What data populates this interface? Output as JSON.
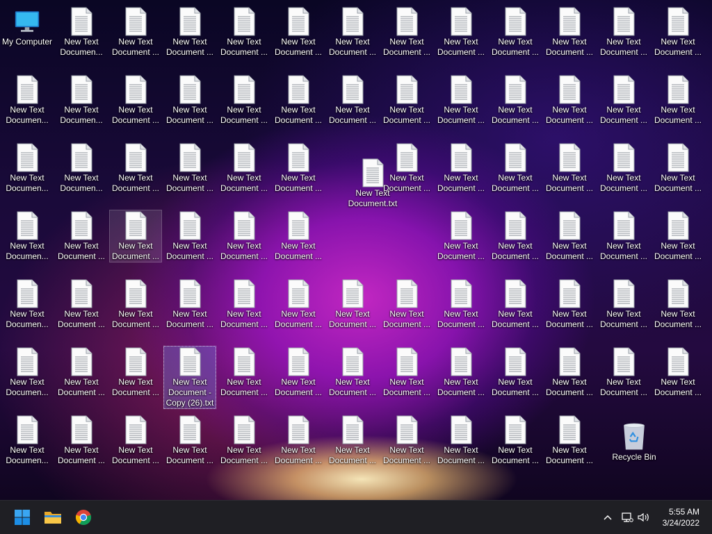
{
  "desktop": {
    "my_computer": "My Computer",
    "recycle_bin": "Recycle Bin",
    "truncated_labels": [
      "New Text\nDocumen...",
      "New Text\nDocument ..."
    ],
    "full_label": "New Text\nDocument.txt",
    "selected_label": "New Text\nDocument -\nCopy (26).txt",
    "hover_label": "New Text\nDocument ..."
  },
  "taskbar": {
    "start": "windows-start-icon",
    "file_explorer": "folder-icon",
    "chrome": "chrome-icon",
    "time": "5:55 AM",
    "date": "3/24/2022"
  },
  "colors": {
    "taskbar": "#1f1f24",
    "selection": "#78a0ff"
  }
}
